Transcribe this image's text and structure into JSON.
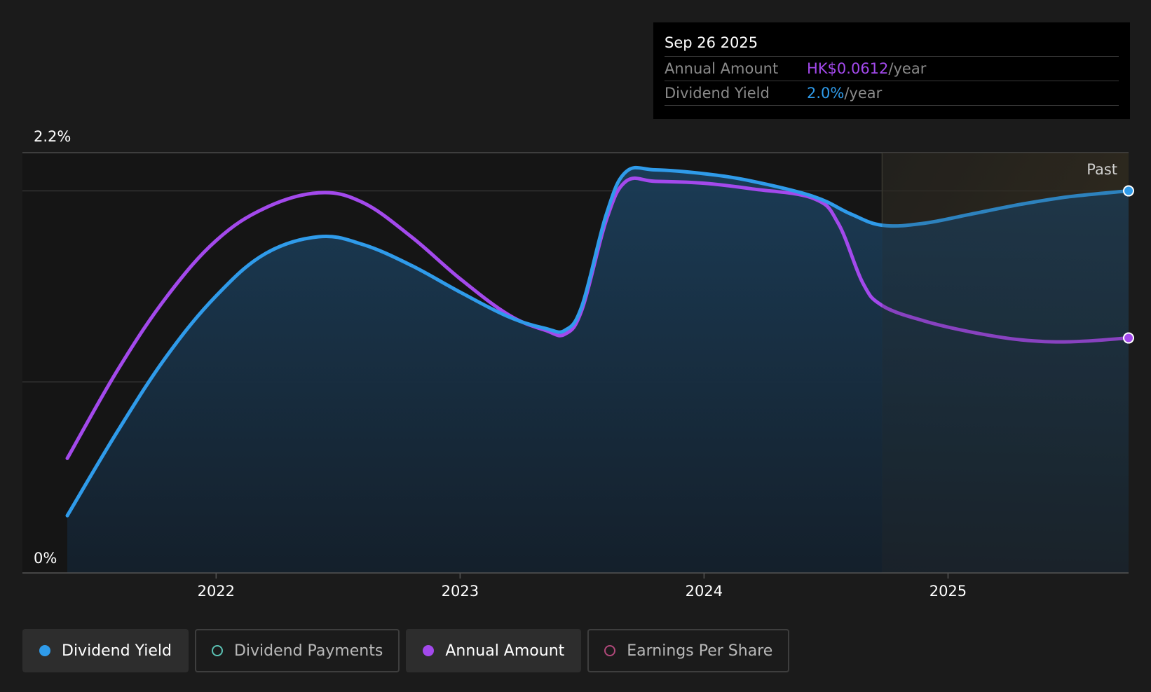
{
  "tooltip": {
    "date": "Sep 26 2025",
    "rows": [
      {
        "label": "Annual Amount",
        "value": "HK$0.0612",
        "unit": "/year",
        "color": "#a349ec"
      },
      {
        "label": "Dividend Yield",
        "value": "2.0%",
        "unit": "/year",
        "color": "#2f9bea"
      }
    ]
  },
  "legend": [
    {
      "label": "Dividend Yield",
      "color": "#2f9bea",
      "active": true,
      "icon": "filled-circle-icon"
    },
    {
      "label": "Dividend Payments",
      "color": "#5bc2b4",
      "active": false,
      "icon": "hollow-circle-icon"
    },
    {
      "label": "Annual Amount",
      "color": "#a349ec",
      "active": true,
      "icon": "filled-circle-icon"
    },
    {
      "label": "Earnings Per Share",
      "color": "#b0487a",
      "active": false,
      "icon": "hollow-circle-icon"
    }
  ],
  "chart_data": {
    "type": "line",
    "title": "",
    "xlabel": "",
    "ylabel": "",
    "y_axis_unit": "%",
    "y_tick_labels": [
      "0%",
      "2.2%"
    ],
    "ylim": [
      0,
      2.2
    ],
    "xlim": [
      2021.39,
      2025.74
    ],
    "x_ticks": [
      2022,
      2023,
      2024,
      2025
    ],
    "x_tick_labels": [
      "2022",
      "2023",
      "2024",
      "2025"
    ],
    "grid": true,
    "past_region": {
      "label": "Past",
      "start": 2024.73,
      "end": 2025.74
    },
    "series": [
      {
        "name": "Dividend Yield",
        "color": "#2f9bea",
        "area_fill": true,
        "points": [
          [
            2021.39,
            0.3
          ],
          [
            2021.6,
            0.75
          ],
          [
            2021.8,
            1.14
          ],
          [
            2022.0,
            1.45
          ],
          [
            2022.2,
            1.67
          ],
          [
            2022.42,
            1.76
          ],
          [
            2022.6,
            1.72
          ],
          [
            2022.8,
            1.61
          ],
          [
            2023.0,
            1.47
          ],
          [
            2023.2,
            1.34
          ],
          [
            2023.35,
            1.28
          ],
          [
            2023.43,
            1.27
          ],
          [
            2023.5,
            1.4
          ],
          [
            2023.6,
            1.88
          ],
          [
            2023.68,
            2.1
          ],
          [
            2023.8,
            2.11
          ],
          [
            2024.0,
            2.09
          ],
          [
            2024.2,
            2.05
          ],
          [
            2024.45,
            1.97
          ],
          [
            2024.6,
            1.88
          ],
          [
            2024.73,
            1.82
          ],
          [
            2024.9,
            1.83
          ],
          [
            2025.1,
            1.88
          ],
          [
            2025.3,
            1.93
          ],
          [
            2025.5,
            1.97
          ],
          [
            2025.74,
            2.0
          ]
        ]
      },
      {
        "name": "Annual Amount",
        "color": "#a349ec",
        "area_fill": false,
        "points": [
          [
            2021.39,
            0.6
          ],
          [
            2021.6,
            1.07
          ],
          [
            2021.8,
            1.45
          ],
          [
            2022.0,
            1.74
          ],
          [
            2022.2,
            1.91
          ],
          [
            2022.42,
            1.99
          ],
          [
            2022.6,
            1.94
          ],
          [
            2022.8,
            1.76
          ],
          [
            2023.0,
            1.54
          ],
          [
            2023.2,
            1.35
          ],
          [
            2023.35,
            1.27
          ],
          [
            2023.43,
            1.25
          ],
          [
            2023.5,
            1.38
          ],
          [
            2023.6,
            1.85
          ],
          [
            2023.68,
            2.05
          ],
          [
            2023.8,
            2.05
          ],
          [
            2024.0,
            2.04
          ],
          [
            2024.2,
            2.01
          ],
          [
            2024.45,
            1.96
          ],
          [
            2024.55,
            1.83
          ],
          [
            2024.65,
            1.52
          ],
          [
            2024.73,
            1.4
          ],
          [
            2024.9,
            1.32
          ],
          [
            2025.1,
            1.26
          ],
          [
            2025.3,
            1.22
          ],
          [
            2025.5,
            1.21
          ],
          [
            2025.74,
            1.23
          ]
        ]
      }
    ]
  }
}
